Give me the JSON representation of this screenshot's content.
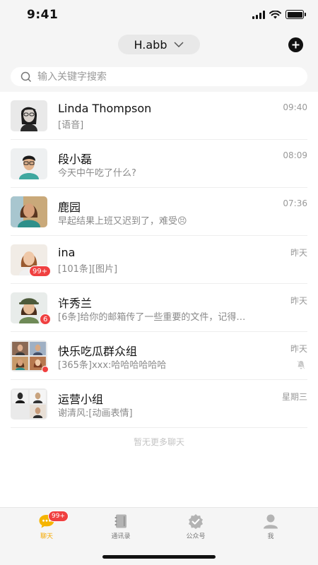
{
  "status_bar": {
    "time": "9:41"
  },
  "header": {
    "account_name": "H.abb"
  },
  "search": {
    "placeholder": "输入关键字搜索"
  },
  "chats": [
    {
      "name": "Linda Thompson",
      "preview": "[语音]",
      "time": "09:40"
    },
    {
      "name": "段小磊",
      "preview": "今天中午吃了什么?",
      "time": "08:09"
    },
    {
      "name": "鹿园",
      "preview": "早起结果上班又迟到了，难受😣",
      "time": "07:36"
    },
    {
      "name": "ina",
      "preview": "[101条][图片]",
      "time": "昨天",
      "badge": "99+"
    },
    {
      "name": "许秀兰",
      "preview": "[6条]给你的邮箱传了一些重要的文件，记得…",
      "time": "昨天",
      "badge": "6"
    },
    {
      "name": "快乐吃瓜群众组",
      "preview": "[365条]xxx:哈哈哈哈哈哈",
      "time": "昨天",
      "muted": true
    },
    {
      "name": "运营小组",
      "preview": "谢清风:[动画表情]",
      "time": "星期三"
    }
  ],
  "list_end_text": "暂无更多聊天",
  "tabs": [
    {
      "label": "聊天",
      "icon": "chat-bubble-icon",
      "active": true,
      "badge": "99+"
    },
    {
      "label": "通讯录",
      "icon": "contacts-book-icon",
      "active": false
    },
    {
      "label": "公众号",
      "icon": "verified-badge-icon",
      "active": false
    },
    {
      "label": "我",
      "icon": "person-icon",
      "active": false
    }
  ],
  "colors": {
    "accent": "#f5a900",
    "badge": "#f04040",
    "background": "#f5f5f5"
  }
}
